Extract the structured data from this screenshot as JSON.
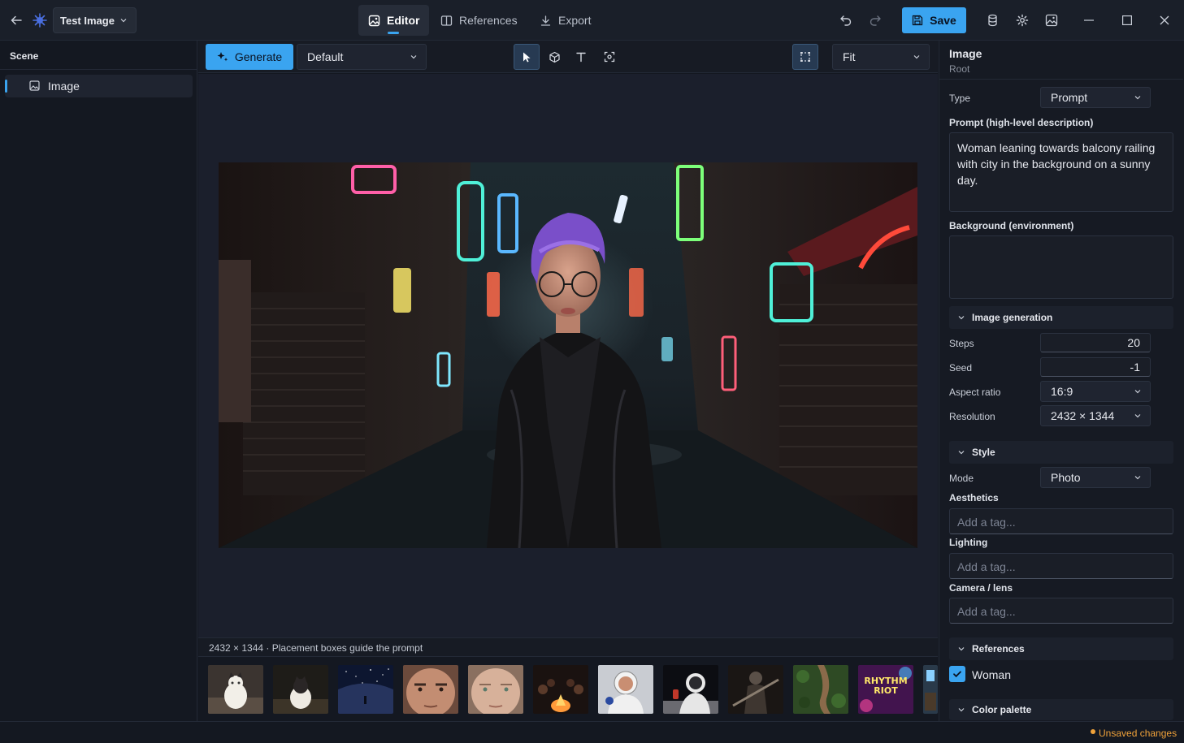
{
  "app": {
    "document_title": "Test Image"
  },
  "nav": {
    "tabs": [
      {
        "label": "Editor",
        "active": true,
        "icon": "image-icon"
      },
      {
        "label": "References",
        "active": false,
        "icon": "book-icon"
      },
      {
        "label": "Export",
        "active": false,
        "icon": "download-icon"
      }
    ],
    "save_label": "Save"
  },
  "scene": {
    "header": "Scene",
    "items": [
      {
        "label": "Image",
        "icon": "image-icon",
        "selected": true
      }
    ]
  },
  "toolbar": {
    "generate_label": "Generate",
    "preset_value": "Default",
    "zoom_value": "Fit",
    "tools": [
      "pointer-icon",
      "cube-icon",
      "text-icon",
      "scan-icon"
    ]
  },
  "canvas": {
    "status_text": "2432 × 1344 · Placement boxes guide the prompt"
  },
  "thumbnails": [
    {
      "name": "thumb-cat-street"
    },
    {
      "name": "thumb-cat-dark"
    },
    {
      "name": "thumb-night-sky"
    },
    {
      "name": "thumb-face-man"
    },
    {
      "name": "thumb-face-woman"
    },
    {
      "name": "thumb-campfire"
    },
    {
      "name": "thumb-astronaut"
    },
    {
      "name": "thumb-astronaut-moon"
    },
    {
      "name": "thumb-knight"
    },
    {
      "name": "thumb-forest-aerial"
    },
    {
      "name": "thumb-rhythm-riot",
      "text": "RHYTHM RIOT"
    },
    {
      "name": "thumb-partial"
    }
  ],
  "properties": {
    "title": "Image",
    "subtitle": "Root",
    "type_label": "Type",
    "type_value": "Prompt",
    "prompt_label": "Prompt (high-level description)",
    "prompt_value": "Woman leaning towards balcony railing with city in the background on a sunny day.",
    "background_label": "Background (environment)",
    "background_value": "",
    "image_generation": {
      "header": "Image generation",
      "steps_label": "Steps",
      "steps_value": "20",
      "seed_label": "Seed",
      "seed_value": "-1",
      "aspect_label": "Aspect ratio",
      "aspect_value": "16:9",
      "resolution_label": "Resolution",
      "resolution_value": "2432 × 1344"
    },
    "style": {
      "header": "Style",
      "mode_label": "Mode",
      "mode_value": "Photo",
      "aesthetics_label": "Aesthetics",
      "aesthetics_placeholder": "Add a tag...",
      "lighting_label": "Lighting",
      "lighting_placeholder": "Add a tag...",
      "camera_label": "Camera / lens",
      "camera_placeholder": "Add a tag..."
    },
    "references": {
      "header": "References",
      "items": [
        {
          "label": "Woman",
          "checked": true
        }
      ]
    },
    "color_palette": {
      "header": "Color palette"
    }
  },
  "status": {
    "unsaved_text": "Unsaved changes"
  },
  "colors": {
    "accent": "#3aa4f0",
    "unsaved_dot": "#f0a23a",
    "background": "#141821"
  }
}
